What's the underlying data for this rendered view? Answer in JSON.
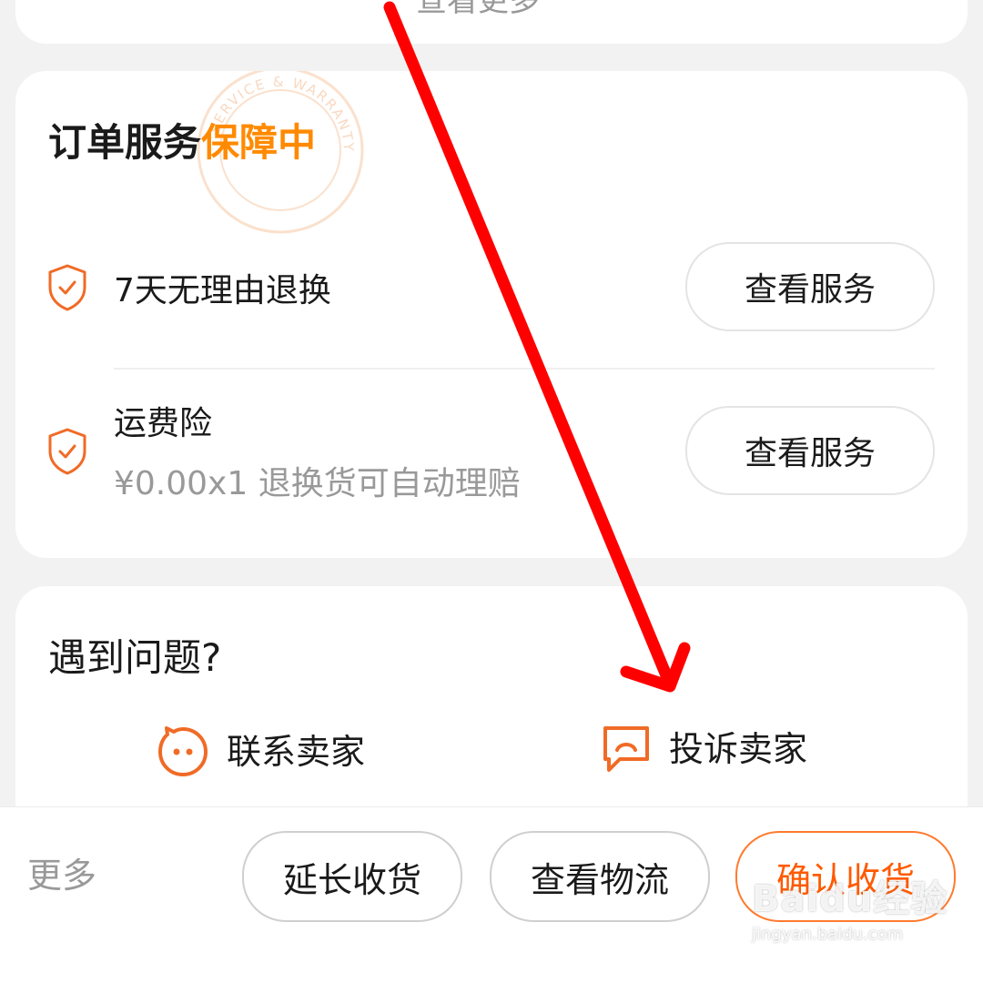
{
  "top_card": {
    "partial_text": "查看更多"
  },
  "order_service": {
    "title": "订单服务",
    "title_accent": "保障中",
    "stamp_text": "SERVICE & WARRANTY",
    "items": [
      {
        "name": "7天无理由退换",
        "description": "",
        "button_label": "查看服务",
        "icon": "shield-check-icon"
      },
      {
        "name": "运费险",
        "description": "¥0.00x1 退换货可自动理赔",
        "button_label": "查看服务",
        "icon": "shield-check-icon"
      }
    ]
  },
  "problem": {
    "title": "遇到问题?",
    "contact_seller": {
      "label": "联系卖家",
      "icon": "chat-smile-icon"
    },
    "complain_seller": {
      "label": "投诉卖家",
      "icon": "complaint-bubble-icon"
    }
  },
  "bottom_bar": {
    "more_label": "更多",
    "extend_label": "延长收货",
    "logistics_label": "查看物流",
    "confirm_label": "确认收货"
  },
  "watermark": {
    "main": "Baidu经验",
    "sub": "jingyan.baidu.com"
  },
  "colors": {
    "accent_orange": "#ff8a00",
    "icon_orange": "#f06b26",
    "confirm_orange": "#ff5a00",
    "annotation_red": "#ff0000",
    "background": "#f2f2f2"
  }
}
